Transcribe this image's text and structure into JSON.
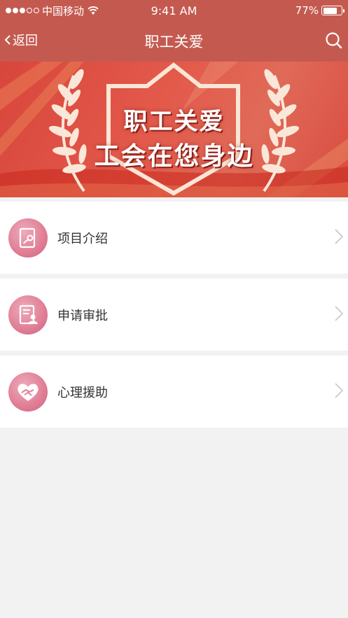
{
  "status_bar": {
    "carrier": "中国移动",
    "time": "9:41 AM",
    "battery_percent": "77%",
    "battery_level": 0.77,
    "signal_full_dots": 3,
    "signal_total_dots": 5
  },
  "nav": {
    "back_label": "返回",
    "title": "职工关爱"
  },
  "banner": {
    "line1": "职工关爱",
    "line2": "工会在您身边"
  },
  "menu": {
    "items": [
      {
        "label": "项目介绍",
        "icon": "project-intro-icon"
      },
      {
        "label": "申请审批",
        "icon": "application-approval-icon"
      },
      {
        "label": "心理援助",
        "icon": "psychological-aid-icon"
      }
    ]
  },
  "colors": {
    "nav_bg": "#c45a4f",
    "banner_red": "#d8463c",
    "icon_pink": "#e07d95",
    "page_bg": "#f2f2f2"
  }
}
